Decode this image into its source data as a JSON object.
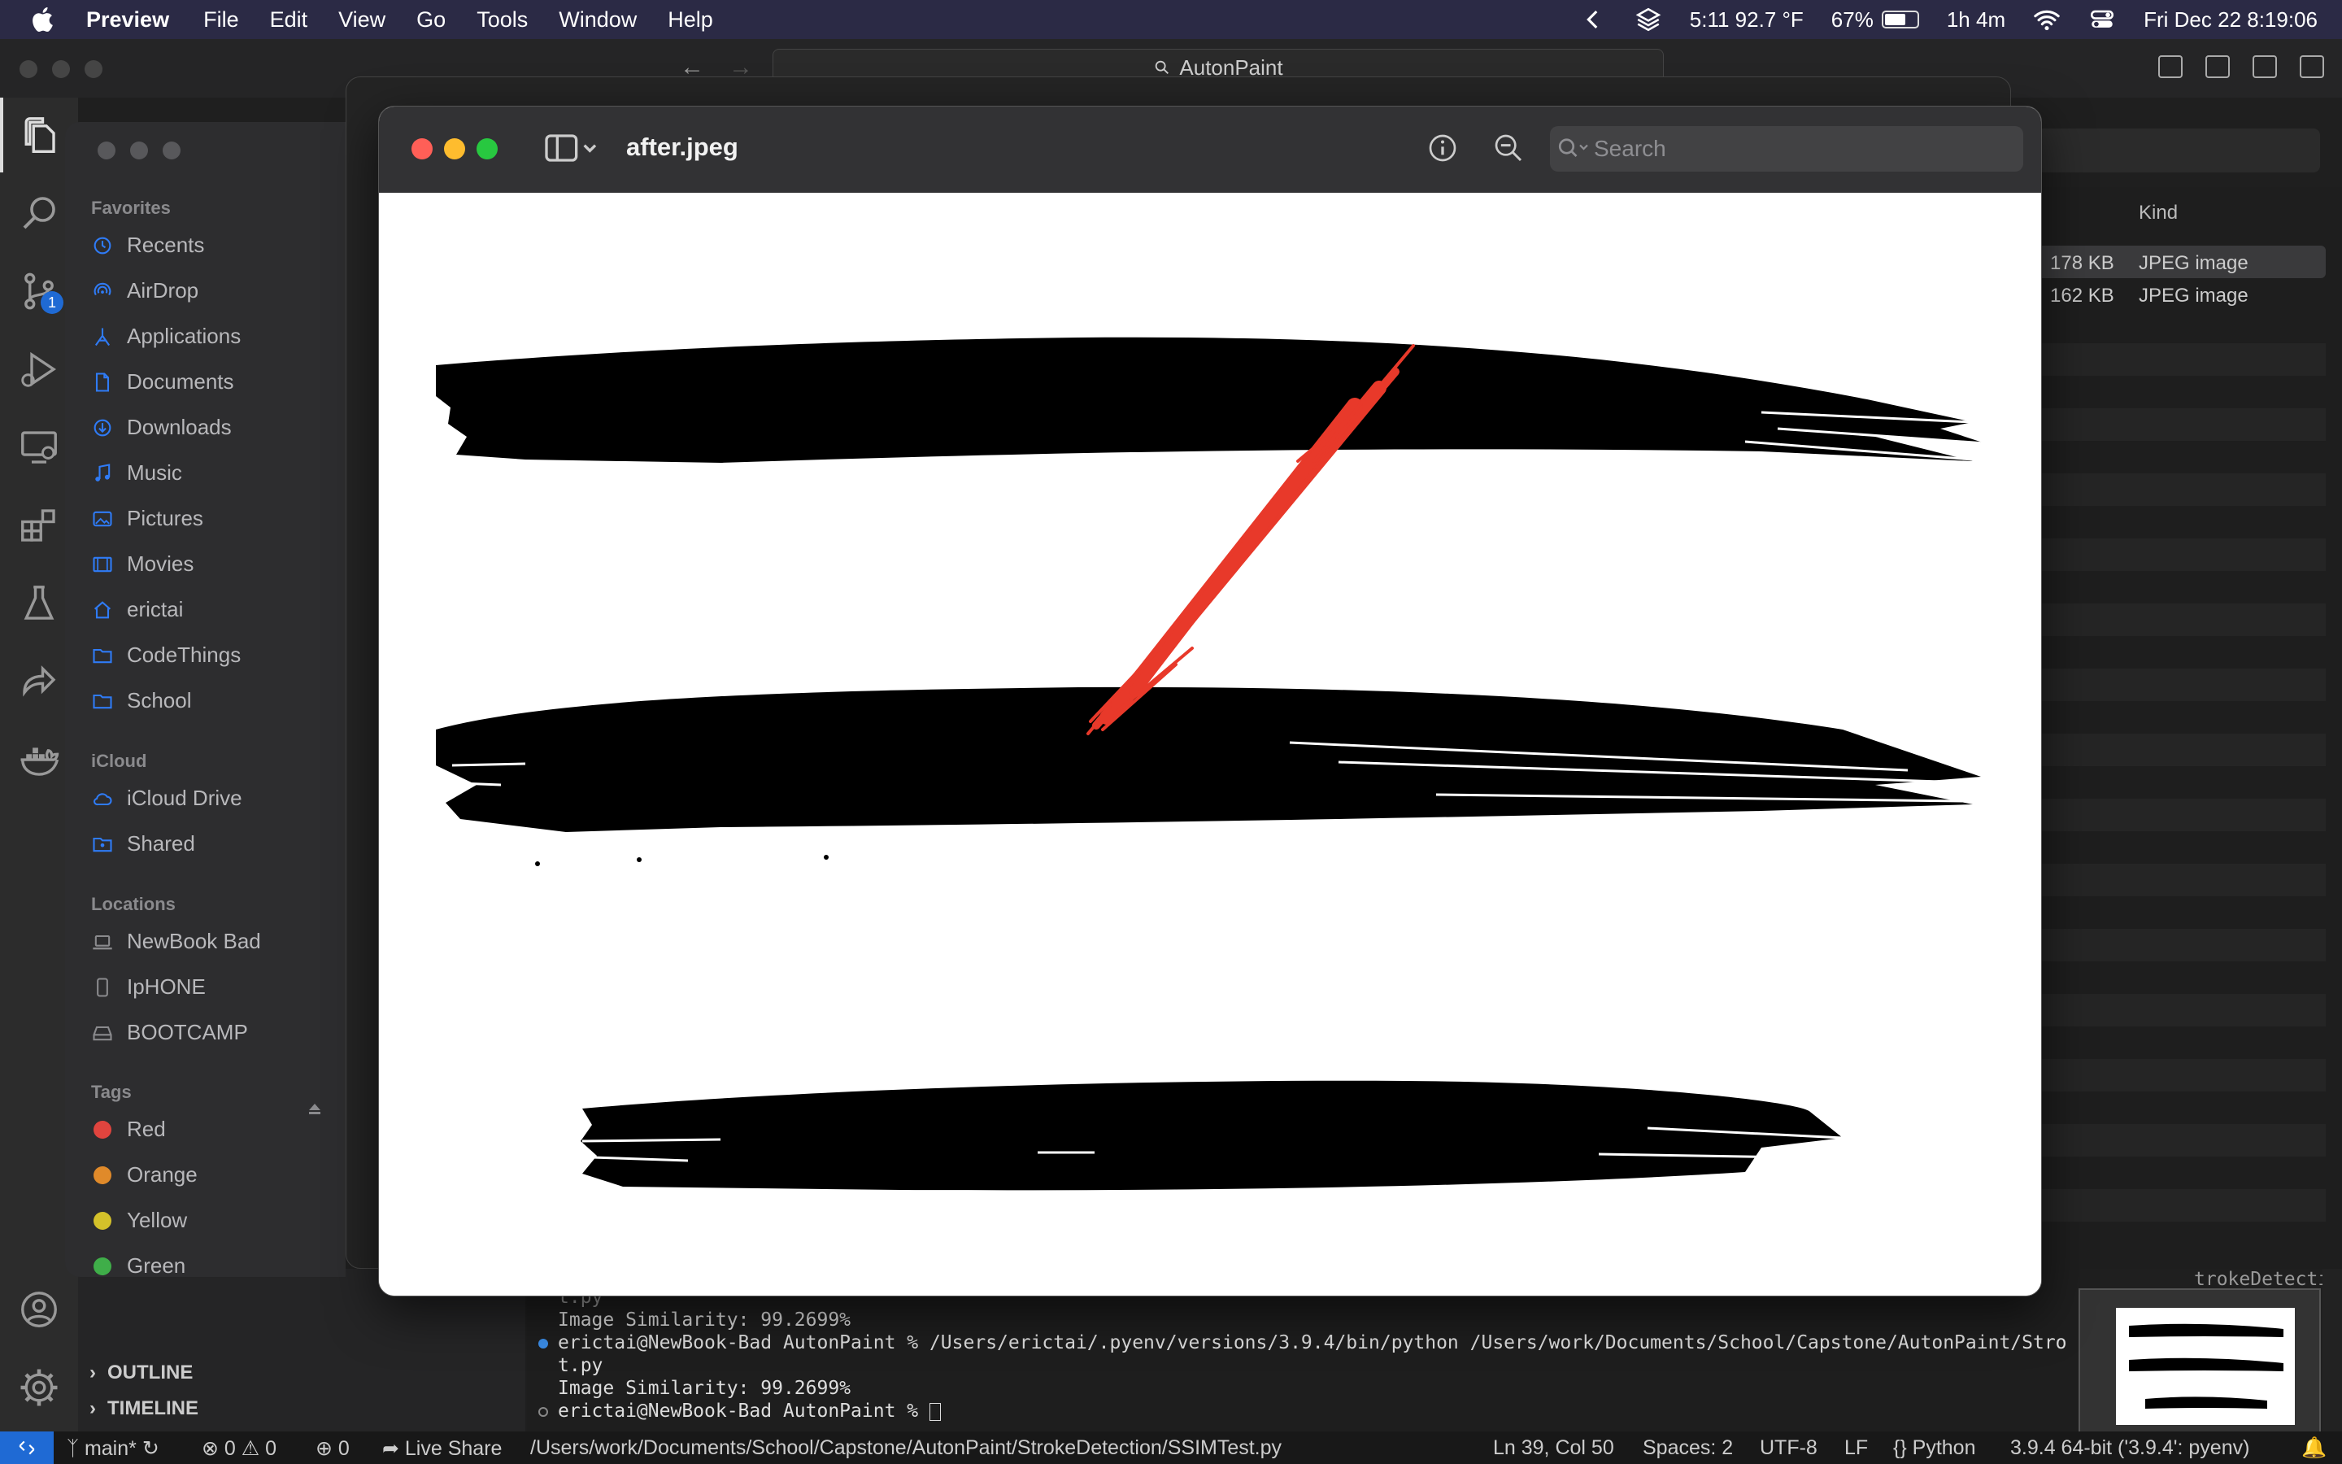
{
  "menubar": {
    "app_name": "Preview",
    "menus": [
      "File",
      "Edit",
      "View",
      "Go",
      "Tools",
      "Window",
      "Help"
    ],
    "status": {
      "weather": "5:11 92.7 °F",
      "battery": "67%",
      "battery_level": 0.67,
      "time_remaining": "1h 4m",
      "datetime": "Fri Dec 22  8:19:06"
    }
  },
  "vscode": {
    "search_label": "AutonPaint",
    "activity": {
      "source_control_badge": "1"
    },
    "sections": {
      "outline": "OUTLINE",
      "timeline": "TIMELINE"
    },
    "terminal": {
      "lines": [
        "t.py",
        "Image Similarity: 99.2699%",
        "erictai@NewBook-Bad AutonPaint % /Users/erictai/.pyenv/versions/3.9.4/bin/python /Users/work/Documents/School/Capstone/AutonPaint/Stro",
        "t.py",
        "Image Similarity: 99.2699%",
        "erictai@NewBook-Bad AutonPaint % "
      ],
      "top_fragment": "trokeDetection/SSIMTes"
    },
    "statusbar": {
      "branch": "main*",
      "errors": "0",
      "warnings": "0",
      "ports": "0",
      "live_share": "Live Share",
      "path": "/Users/work/Documents/School/Capstone/AutonPaint/StrokeDetection/SSIMTest.py",
      "cursor": "Ln 39, Col 50",
      "spaces": "Spaces: 2",
      "encoding": "UTF-8",
      "eol": "LF",
      "language": "Python",
      "interpreter": "3.9.4 64-bit ('3.9.4': pyenv)"
    }
  },
  "finder": {
    "sections": {
      "favorites": "Favorites",
      "icloud": "iCloud",
      "locations": "Locations",
      "tags": "Tags"
    },
    "favorites": [
      {
        "label": "Recents",
        "icon": "clock-icon"
      },
      {
        "label": "AirDrop",
        "icon": "airdrop-icon"
      },
      {
        "label": "Applications",
        "icon": "applications-icon"
      },
      {
        "label": "Documents",
        "icon": "document-icon"
      },
      {
        "label": "Downloads",
        "icon": "download-icon"
      },
      {
        "label": "Music",
        "icon": "music-icon"
      },
      {
        "label": "Pictures",
        "icon": "pictures-icon"
      },
      {
        "label": "Movies",
        "icon": "movies-icon"
      },
      {
        "label": "erictai",
        "icon": "home-icon"
      },
      {
        "label": "CodeThings",
        "icon": "folder-icon"
      },
      {
        "label": "School",
        "icon": "folder-icon"
      }
    ],
    "icloud": [
      {
        "label": "iCloud Drive",
        "icon": "cloud-icon"
      },
      {
        "label": "Shared",
        "icon": "shared-folder-icon"
      }
    ],
    "locations": [
      {
        "label": "NewBook Bad",
        "icon": "laptop-icon"
      },
      {
        "label": "IpHONE",
        "icon": "phone-icon"
      },
      {
        "label": "BOOTCAMP",
        "icon": "drive-icon"
      }
    ],
    "tags": [
      {
        "label": "Red",
        "color": "#e0443e"
      },
      {
        "label": "Orange",
        "color": "#e08a2a"
      },
      {
        "label": "Yellow",
        "color": "#d4c12a"
      },
      {
        "label": "Green",
        "color": "#3fae49"
      }
    ],
    "list": {
      "kind_header": "Kind",
      "rows": [
        {
          "size": "178 KB",
          "kind": "JPEG image"
        },
        {
          "size": "162 KB",
          "kind": "JPEG image"
        }
      ]
    }
  },
  "preview": {
    "title": "after.jpeg",
    "search_placeholder": "Search"
  },
  "colors": {
    "accent": "#1f6ad4",
    "stroke_red": "#e8392a",
    "close": "#ff5f57",
    "minimize": "#febc2e",
    "zoom": "#28c840"
  }
}
